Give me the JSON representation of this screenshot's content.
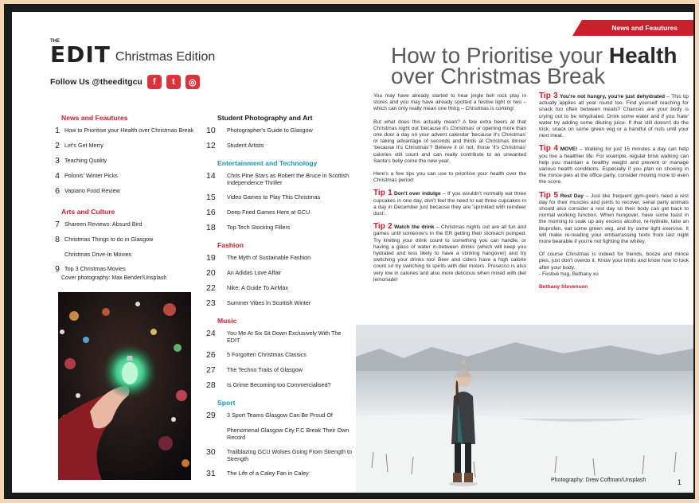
{
  "masthead": {
    "the": "THE",
    "logo": "EDIT",
    "edition": "Christmas Edition",
    "follow": "Follow Us @theeditgcu"
  },
  "social": [
    {
      "icon": "facebook-icon",
      "glyph": "f"
    },
    {
      "icon": "twitter-icon",
      "glyph": "t"
    },
    {
      "icon": "instagram-icon",
      "glyph": "◎"
    }
  ],
  "toc_left": [
    {
      "heading": "News and Feautures",
      "color": "red",
      "items": [
        {
          "num": "1",
          "title": "How to Prioritise your Health over Christmas Break"
        },
        {
          "num": "2",
          "title": "Let's Get Merry"
        },
        {
          "num": "3",
          "title": "Teaching Quality"
        },
        {
          "num": "4",
          "title": "Polonis' Winter Picks"
        },
        {
          "num": "6",
          "title": "Vapiano Food Review"
        }
      ]
    },
    {
      "heading": "Arts and Culture",
      "color": "red",
      "items": [
        {
          "num": "7",
          "title": "Shareen Reviews: Absurd Bird"
        },
        {
          "num": "8",
          "title": "Christmas Things to do in Glasgow"
        },
        {
          "num": "",
          "title": "Christmas Drive-In Movies"
        },
        {
          "num": "9",
          "title": "Top 3 Christmas Movies"
        }
      ]
    }
  ],
  "cover_credit": "Cover photography: Max Bender/Unsplash",
  "toc_right": [
    {
      "heading": "Student Photography and Art",
      "color": "dark",
      "items": [
        {
          "num": "10",
          "title": "Photographer's Guide to Glasgow"
        },
        {
          "num": "12",
          "title": "Student Artists"
        }
      ]
    },
    {
      "heading": "Entertainment and Technology",
      "color": "teal",
      "items": [
        {
          "num": "14",
          "title": "Chris Pine Stars as Robert the Bruce in Scottish Independence Thriller"
        },
        {
          "num": "15",
          "title": "Video Games to Play This Christmas"
        },
        {
          "num": "16",
          "title": "Deep Fried Games Here at GCU"
        },
        {
          "num": "18",
          "title": "Top Tech Stocking Fillers"
        }
      ]
    },
    {
      "heading": "Fashion",
      "color": "red",
      "items": [
        {
          "num": "19",
          "title": "The Myth of Sustainable Fashion"
        },
        {
          "num": "20",
          "title": "An Adidas Love Affair"
        },
        {
          "num": "22",
          "title": "Nike: A Guide To AirMax"
        },
        {
          "num": "23",
          "title": "Summer Vibes In Scottish Winter"
        }
      ]
    },
    {
      "heading": "Music",
      "color": "red",
      "items": [
        {
          "num": "24",
          "title": "You Me At Six Sit Down Exclusively With The EDIT"
        },
        {
          "num": "26",
          "title": "5 Forgotten Christmas Classics"
        },
        {
          "num": "27",
          "title": "The Techno Traits of Glasgow"
        },
        {
          "num": "28",
          "title": "Is Grime Becoming too Commercialised?"
        }
      ]
    },
    {
      "heading": "Sport",
      "color": "teal",
      "items": [
        {
          "num": "29",
          "title": "3 Sport Teams Glasgow Can Be Proud Of"
        },
        {
          "num": "",
          "title": "Phenomenal Glasgow City F.C Break Their Own Record"
        },
        {
          "num": "30",
          "title": "Trailblazing GCU Wolves Going From Strength to Strength"
        },
        {
          "num": "31",
          "title": "The Life of a Caley Fan in Caley"
        }
      ]
    }
  ],
  "article": {
    "tag": "News and Feautures",
    "headline_1": "How to Prioritise your ",
    "headline_bold": "Health",
    "headline_2": "over Christmas Break",
    "p1": "You may have already started to hear jingle bell rock play in stores and you may have already spotted a festive light or two – which can only really mean one thing – Christmas is coming!",
    "p2": "But what does this actually mean? A few extra beers at that Christmas night out 'because it's Christmas' or opening more than one door a day on your advent calendar 'because it's Christmas' or taking advantage of seconds and thirds at Christmas dinner 'because it's Christmas'? Believe it or not, those 'it's Christmas' calories still count and can really contribute to an unwanted Santa's belly come the new year.",
    "p3": "Here's a few tips you can use to prioritise your health over the Christmas period:",
    "tip1_label": "Tip 1",
    "tip1_sub": "Don't over indulge",
    "tip1_text": " – If you wouldn't normally eat three cupcakes in one day, don't feel the need to eat three cupcakes in a day in December just because they are 'sprinkled with reindeer dust'.",
    "tip2_label": "Tip 2",
    "tip2_sub": "Watch the drink",
    "tip2_text": " – Christmas nights out are all fun and games until someone's in the ER getting their stomach pumped. Try limiting your drink count to something you can handle, or having a glass of water in-between drinks (which will keep you hydrated and less likely to have a stinking hangover) and try switching your drinks too! Beer and ciders have a high calorie count so try switching to spirits with diet mixers. Prosecco is also very low in calories and also more delicious when mixed with diet lemonade!",
    "tip3_label": "Tip 3",
    "tip3_sub": "You're not hungry, you're just dehydrated",
    "tip3_text": " – This tip actually applies all year round too. Find yourself reaching for snack too often between meals? Chances are your body is crying out to be rehydrated. Drink some water and if you 'hate' water try adding some diluting juice. If that still doesn't do the trick, snack on some green veg or a handful of nuts until your next meal.",
    "tip4_label": "Tip 4",
    "tip4_sub": "MOVE!",
    "tip4_text": " – Walking for just 15 minutes a day can help you live a healthier life. For example, regular brisk walking can help you maintain a healthy weight and prevent or manage various health conditions. Especially if you plan on shoving in the mince pies at the office party, consider moving more to even the score.",
    "tip5_label": "Tip 5",
    "tip5_sub": "Rest Day",
    "tip5_text": " – Just like frequent gym-goers need a rest day for their muscles and joints to recover, serial party animals should also consider a rest day so their body can get back to normal working function. When hungover, have some toast in the morning to soak up any excess alcohol, re-hydrate, take an ibuprofen, eat some green veg, and try some light exercise. It will make re-reading your embarrassing texts from last night more bearable if you're not fighting the whitey.",
    "closing": "Of course Christmas is indeed for friends, booze and mince pies, just don't overdo it. Know your limits and know how to look after your body.",
    "signoff": "- Festive hug, Bethany xo",
    "author": "Bethany Stevenson",
    "photo_credit": "Photography: Drew Coffman/Unsplash",
    "page_number": "1"
  }
}
